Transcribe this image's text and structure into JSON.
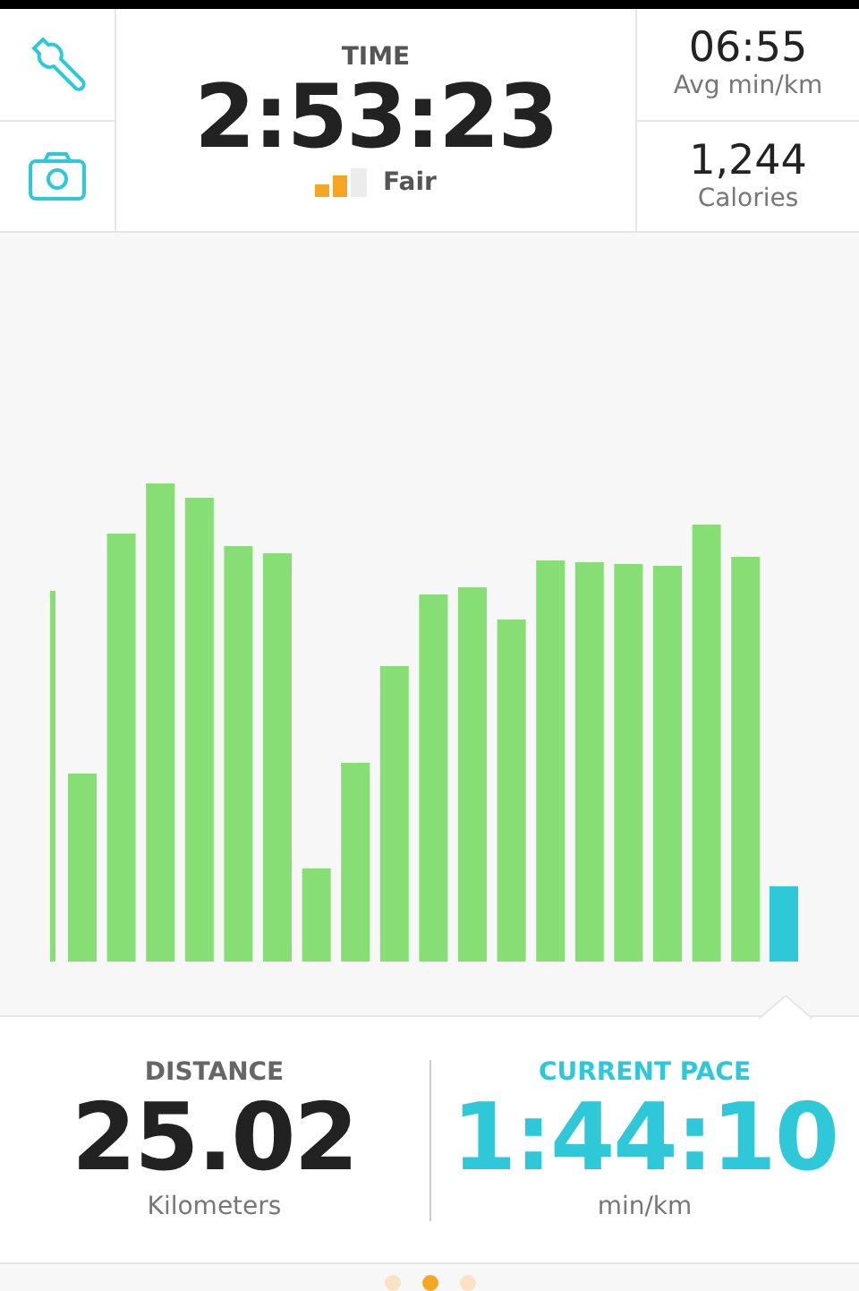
{
  "header": {
    "time_label": "TIME",
    "time": "2:53:23",
    "gps": "Fair",
    "avg_pace": "06:55",
    "avg_pace_label": "Avg min/km",
    "calories": "1,244",
    "calories_label": "Calories"
  },
  "stats": [
    {
      "label": "DISTANCE",
      "value": "25.02",
      "unit": "Kilometers",
      "kind": "plain"
    },
    {
      "label": "CURRENT PACE",
      "value": "1:44:10",
      "unit": "min/km",
      "kind": "highlight"
    }
  ],
  "pages": [
    {
      "selected": false
    },
    {
      "selected": true
    },
    {
      "selected": false
    }
  ]
}
